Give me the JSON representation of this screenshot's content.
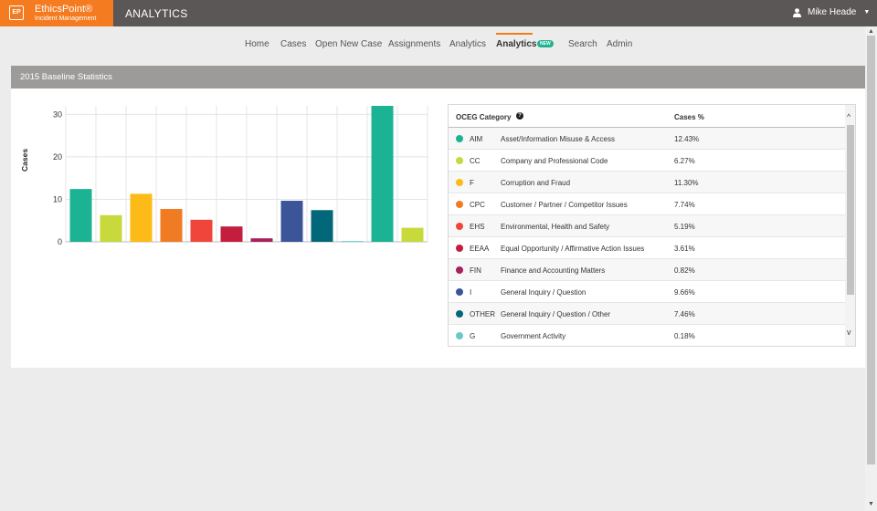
{
  "brand": {
    "logo_text": "EP",
    "name": "EthicsPoint®",
    "sub": "Incident Management"
  },
  "app_title": "ANALYTICS",
  "user": {
    "name": "Mike Heade",
    "caret": "▼"
  },
  "nav": {
    "items": [
      "Home",
      "Cases",
      "Open New Case",
      "Assignments",
      "Analytics",
      "Analytics",
      "Search",
      "Admin"
    ],
    "new_badge": "NEW"
  },
  "panel": {
    "title": "2015 Baseline Statistics"
  },
  "table": {
    "headers": {
      "category": "OCEG Category",
      "help": "?",
      "percent": "Cases %"
    },
    "rows": [
      {
        "code": "AIM",
        "name": "Asset/Information Misuse & Access",
        "pct": "12.43%",
        "color": "#1cb394"
      },
      {
        "code": "CC",
        "name": "Company and Professional Code",
        "pct": "6.27%",
        "color": "#c8d93b"
      },
      {
        "code": "F",
        "name": "Corruption and Fraud",
        "pct": "11.30%",
        "color": "#fcbb16"
      },
      {
        "code": "CPC",
        "name": "Customer / Partner / Competitor Issues",
        "pct": "7.74%",
        "color": "#f07b22"
      },
      {
        "code": "EHS",
        "name": "Environmental, Health and Safety",
        "pct": "5.19%",
        "color": "#f0453b"
      },
      {
        "code": "EEAA",
        "name": "Equal Opportunity / Affirmative Action Issues",
        "pct": "3.61%",
        "color": "#c41e3f"
      },
      {
        "code": "FIN",
        "name": "Finance and Accounting Matters",
        "pct": "0.82%",
        "color": "#a8205c"
      },
      {
        "code": "I",
        "name": "General Inquiry / Question",
        "pct": "9.66%",
        "color": "#3c5498"
      },
      {
        "code": "OTHER",
        "name": "General Inquiry / Question / Other",
        "pct": "7.46%",
        "color": "#03677a"
      },
      {
        "code": "G",
        "name": "Government Activity",
        "pct": "0.18%",
        "color": "#6cc7c8"
      }
    ]
  },
  "scroll": {
    "up": "^",
    "down": "v"
  },
  "chart_data": {
    "type": "bar",
    "ylabel": "Cases",
    "ylim": [
      0,
      32
    ],
    "yticks": [
      "0",
      "10",
      "20",
      "30"
    ],
    "values": [
      12.43,
      6.27,
      11.3,
      7.74,
      5.19,
      3.61,
      0.82,
      9.66,
      7.46,
      0.18,
      32,
      3.3
    ],
    "colors": [
      "#1cb394",
      "#c8d93b",
      "#fcbb16",
      "#f07b22",
      "#f0453b",
      "#c41e3f",
      "#a8205c",
      "#3c5498",
      "#03677a",
      "#6cc7c8",
      "#1cb394",
      "#c8d93b"
    ],
    "grid": true
  }
}
